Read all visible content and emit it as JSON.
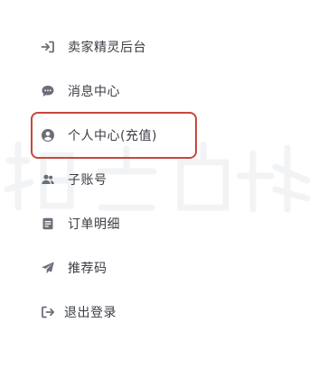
{
  "menu": {
    "items": [
      {
        "label": "卖家精灵后台",
        "icon": "login-arrow-icon"
      },
      {
        "label": "消息中心",
        "icon": "chat-bubble-icon"
      },
      {
        "label": "个人中心(充值)",
        "icon": "user-circle-icon"
      },
      {
        "label": "子账号",
        "icon": "users-icon"
      },
      {
        "label": "订单明细",
        "icon": "document-icon"
      },
      {
        "label": "推荐码",
        "icon": "paper-plane-icon"
      },
      {
        "label": "退出登录",
        "icon": "logout-icon"
      }
    ]
  },
  "highlight": {
    "target": "个人中心(充值)",
    "color": "#c8473a"
  },
  "colors": {
    "icon": "#6b6f78",
    "text": "#3a3d44",
    "watermark": "#f2f4f6"
  }
}
